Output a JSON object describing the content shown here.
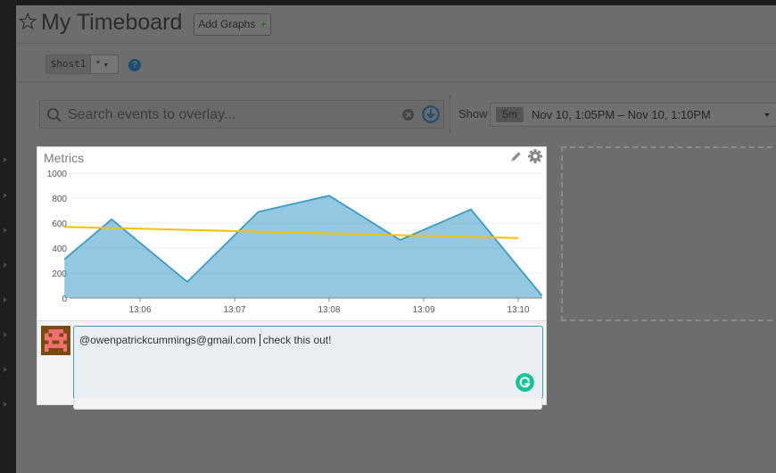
{
  "header": {
    "title": "My Timeboard",
    "add_graphs_label": "Add Graphs",
    "add_graphs_plus": "+"
  },
  "template_variable": {
    "name": "$host1",
    "value": "*"
  },
  "search": {
    "placeholder": "Search events to overlay..."
  },
  "time": {
    "show_label": "Show",
    "badge": "5m",
    "range": "Nov 10, 1:05PM – Nov 10, 1:10PM"
  },
  "widget": {
    "title": "Metrics"
  },
  "chart_data": {
    "type": "area",
    "title": "Metrics",
    "xlabel": "",
    "ylabel": "",
    "ylim": [
      0,
      1000
    ],
    "y_ticks": [
      "0",
      "200",
      "400",
      "600",
      "800",
      "1000"
    ],
    "x_ticks": [
      "13:06",
      "13:07",
      "13:08",
      "13:09",
      "13:10"
    ],
    "x_tick_positions_minutes": [
      6,
      7,
      8,
      9,
      10
    ],
    "grid": true,
    "series": [
      {
        "values_x": [
          5.2,
          5.7,
          6.5,
          7.25,
          8.0,
          8.75,
          9.5,
          10.25
        ],
        "values_y": [
          310,
          630,
          130,
          690,
          820,
          465,
          710,
          20
        ],
        "color": "#3d9ac6"
      },
      {
        "values_x": [
          5.2,
          10.0
        ],
        "values_y": [
          570,
          480
        ],
        "color": "#f2c200"
      }
    ]
  },
  "comment": {
    "mention": "@owenpatrickcummings@gmail.com",
    "text": "check this out!"
  },
  "colors": {
    "accent_blue": "#3d9ac6",
    "trend_yellow": "#f2c200",
    "grammarly_green": "#15c39a"
  }
}
